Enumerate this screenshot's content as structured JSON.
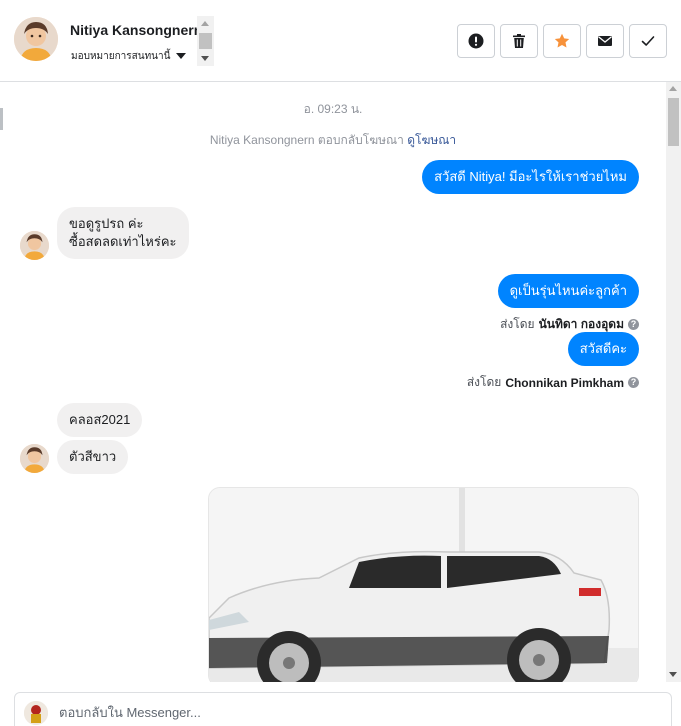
{
  "header": {
    "contact_name": "Nitiya Kansongnern",
    "assign_label": "มอบหมายการสนทนานี้",
    "actions": [
      {
        "name": "mark-spam-button",
        "icon": "exclamation-icon"
      },
      {
        "name": "delete-button",
        "icon": "trash-icon"
      },
      {
        "name": "star-button",
        "icon": "star-icon"
      },
      {
        "name": "mark-unread-button",
        "icon": "envelope-icon"
      },
      {
        "name": "mark-done-button",
        "icon": "check-icon"
      }
    ]
  },
  "chat": {
    "timestamp": "อ. 09:23 น.",
    "system_line": {
      "text": "Nitiya Kansongnern ตอบกลับโฆษณา",
      "link": "ดูโฆษณา"
    },
    "messages": [
      {
        "dir": "out",
        "text": "สวัสดี Nitiya! มีอะไรให้เราช่วยไหม"
      },
      {
        "dir": "in",
        "lines": [
          "ขอดูรูปรถ ค่ะ",
          "ซื้อสดลดเท่าไหร่คะ"
        ]
      },
      {
        "dir": "out",
        "text": "ดูเป็นรุ่นไหนค่ะลูกค้า"
      },
      {
        "dir": "out",
        "text": "สวัสดีคะ"
      },
      {
        "dir": "in",
        "text": "คลอส2021"
      },
      {
        "dir": "in",
        "text": "ตัวสีขาว"
      }
    ],
    "sent_by_label": "ส่งโดย",
    "sent_by": [
      {
        "name": "นันทิดา กองอุดม"
      },
      {
        "name": "Chonnikan Pimkham"
      }
    ],
    "help_glyph": "?"
  },
  "composer": {
    "placeholder": "ตอบกลับใน Messenger..."
  },
  "colors": {
    "outgoing_bubble": "#0084ff",
    "incoming_bubble": "#f1f0f0",
    "star_active": "#f7923b",
    "link": "#385898"
  }
}
